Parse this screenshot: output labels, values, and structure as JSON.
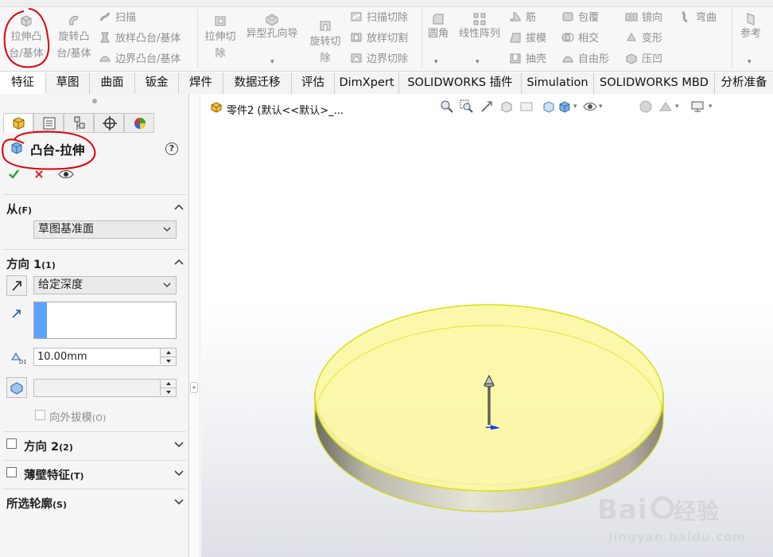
{
  "ribbon": {
    "extrude_boss": [
      "拉伸凸",
      "台/基体"
    ],
    "revolve_boss": [
      "旋转凸",
      "台/基体"
    ],
    "sweep": "扫描",
    "loft_boss": "放样凸台/基体",
    "boundary_boss": "边界凸台/基体",
    "extrude_cut": [
      "拉伸切",
      "除"
    ],
    "hole_wizard": "异型孔向导",
    "revolve_cut": [
      "旋转切",
      "除"
    ],
    "sweep_cut": "扫描切除",
    "loft_cut": "放样切割",
    "boundary_cut": "边界切除",
    "fillet": "圆角",
    "linear_pattern": "线性阵列",
    "rib": "筋",
    "draft": "拔模",
    "shell": "抽壳",
    "wrap": "包覆",
    "intersect": "相交",
    "freeform": "自由形",
    "mirror": "镜向",
    "deform": "变形",
    "indent": "压凹",
    "flex": "弯曲",
    "reference": "参考"
  },
  "tabs": [
    "特征",
    "草图",
    "曲面",
    "钣金",
    "焊件",
    "数据迁移",
    "评估",
    "DimXpert",
    "SOLIDWORKS 插件",
    "Simulation",
    "SOLIDWORKS MBD",
    "分析准备"
  ],
  "panel": {
    "title": "凸台-拉伸",
    "help": "?",
    "from_label": "从",
    "from_key": "(F)",
    "from_value": "草图基准面",
    "dir1_label": "方向 1",
    "dir1_key": "(1)",
    "end_condition": "给定深度",
    "depth": "10.00mm",
    "draft_outward": "向外拔模",
    "draft_outward_key": "(O)",
    "dir2_label": "方向 2",
    "dir2_key": "(2)",
    "thin_label": "薄壁特征",
    "thin_key": "(T)",
    "contours_label": "所选轮廓",
    "contours_key": "(S)"
  },
  "viewport": {
    "tree_label": "零件2  (默认<<默认>_..."
  },
  "colors": {
    "annotation": "#e0000b",
    "preview_fill": "#fbf7a4",
    "preview_edge": "#d6e20f",
    "direction_swatch": "#5aa4ff"
  }
}
